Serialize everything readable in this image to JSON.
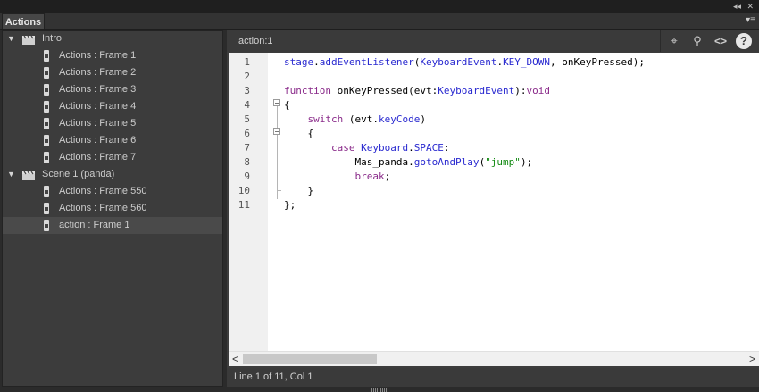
{
  "panel": {
    "tab_label": "Actions"
  },
  "window_controls": {
    "collapse": "◂◂",
    "close": "✕",
    "menu": "▾≡"
  },
  "tree": [
    {
      "type": "scene",
      "label": "Intro"
    },
    {
      "type": "frame",
      "label": "Actions : Frame 1"
    },
    {
      "type": "frame",
      "label": "Actions : Frame 2"
    },
    {
      "type": "frame",
      "label": "Actions : Frame 3"
    },
    {
      "type": "frame",
      "label": "Actions : Frame 4"
    },
    {
      "type": "frame",
      "label": "Actions : Frame 5"
    },
    {
      "type": "frame",
      "label": "Actions : Frame 6"
    },
    {
      "type": "frame",
      "label": "Actions : Frame 7"
    },
    {
      "type": "scene",
      "label": "Scene 1 (panda)"
    },
    {
      "type": "frame",
      "label": "Actions : Frame 550"
    },
    {
      "type": "frame",
      "label": "Actions : Frame 560"
    },
    {
      "type": "frame",
      "label": "action : Frame 1",
      "selected": true
    }
  ],
  "editor": {
    "title": "action:1",
    "tools": [
      "target-icon",
      "find-icon",
      "code-snippets-icon",
      "help-icon"
    ],
    "line_numbers": [
      "1",
      "2",
      "3",
      "4",
      "5",
      "6",
      "7",
      "8",
      "9",
      "10",
      "11"
    ],
    "lines": [
      "stage.addEventListener(KeyboardEvent.KEY_DOWN, onKeyPressed);",
      "",
      "function onKeyPressed(evt:KeyboardEvent):void",
      "{",
      "    switch (evt.keyCode)",
      "    {",
      "        case Keyboard.SPACE:",
      "            Mas_panda.gotoAndPlay(\"jump\");",
      "            break;",
      "    }",
      "};"
    ]
  },
  "status": {
    "text": "Line 1 of 11, Col 1"
  },
  "colors": {
    "keyword": "#8a2b8a",
    "type": "#2a2ad0",
    "string": "#138a13",
    "panel_bg": "#3c3c3c",
    "selection": "#4a4a4a"
  }
}
